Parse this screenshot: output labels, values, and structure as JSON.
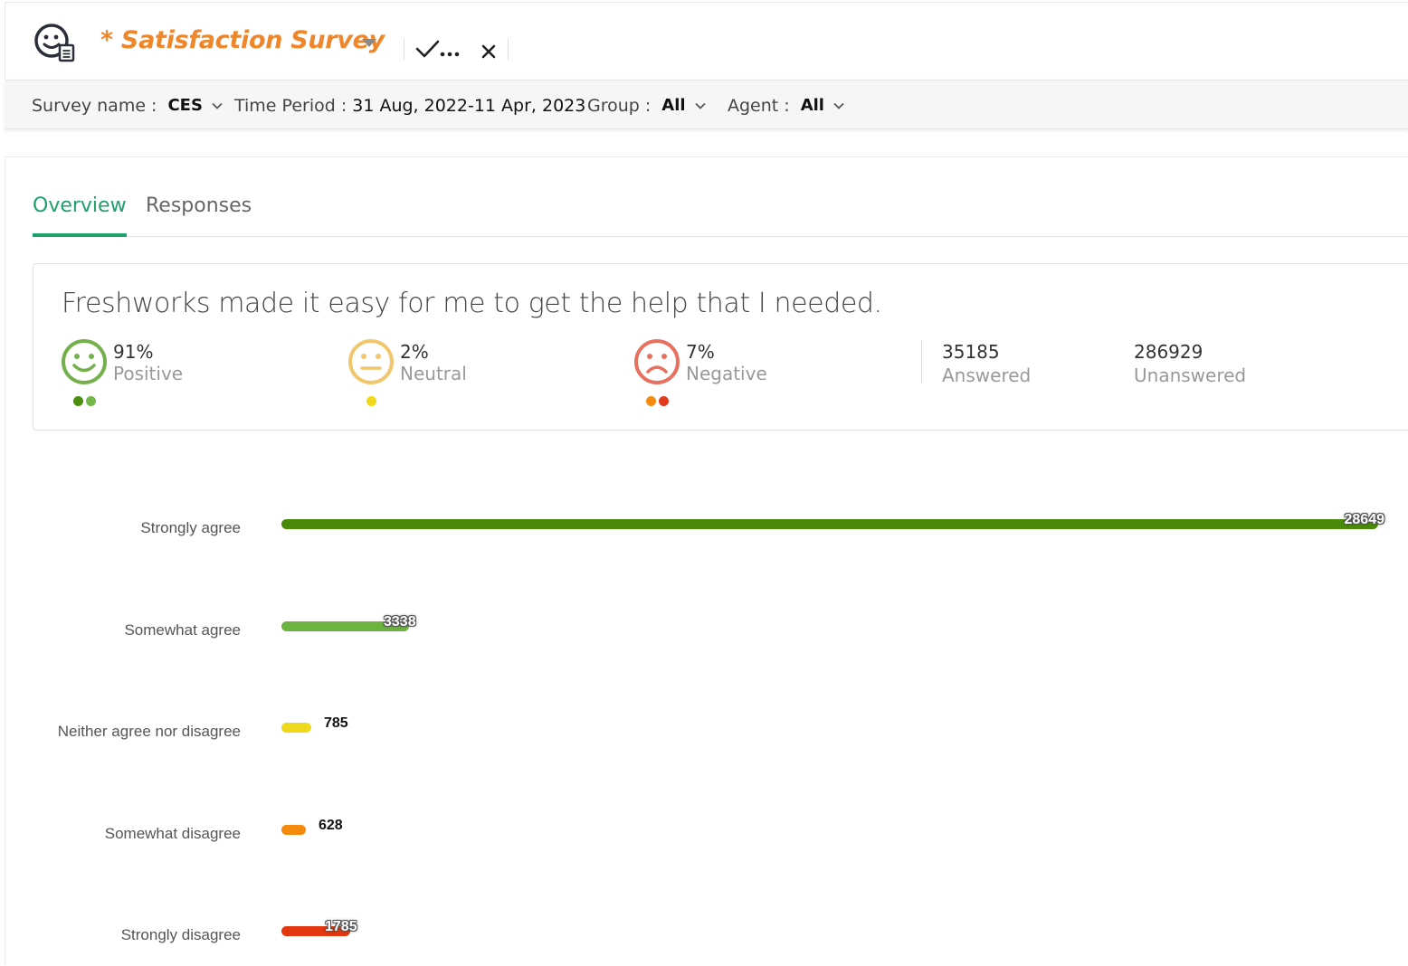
{
  "header": {
    "title": "* Satisfaction Survey",
    "icons": {
      "app": "smiley-document-icon",
      "dropdown": "caret-down-icon",
      "mark": "check-more-icon",
      "close": "close-icon"
    }
  },
  "filters": {
    "survey_name_label": "Survey name :",
    "survey_name_value": "CES",
    "time_period_label": "Time Period :",
    "time_period_value": "31 Aug, 2022-11 Apr, 2023",
    "group_label": "Group :",
    "group_value": "All",
    "agent_label": "Agent :",
    "agent_value": "All"
  },
  "tabs": {
    "overview": "Overview",
    "responses": "Responses"
  },
  "summary": {
    "question": "Freshworks made it easy for me to get the help that I needed.",
    "positive": {
      "pct": "91%",
      "label": "Positive",
      "icon": "smile-face-icon",
      "color": "#74b04c",
      "dots": [
        "#4a8f10",
        "#74b64a"
      ]
    },
    "neutral": {
      "pct": "2%",
      "label": "Neutral",
      "icon": "neutral-face-icon",
      "color": "#f2c66d",
      "dots": [
        "#f0d81a"
      ]
    },
    "negative": {
      "pct": "7%",
      "label": "Negative",
      "icon": "sad-face-icon",
      "color": "#e8705e",
      "dots": [
        "#f58a0f",
        "#e23b1b"
      ]
    },
    "answered": {
      "num": "35185",
      "label": "Answered"
    },
    "unanswered": {
      "num": "286929",
      "label": "Unanswered"
    }
  },
  "chart_data": {
    "type": "bar",
    "orientation": "horizontal",
    "categories": [
      "Strongly agree",
      "Somewhat agree",
      "Neither agree nor disagree",
      "Somewhat disagree",
      "Strongly disagree"
    ],
    "values": [
      28649,
      3338,
      785,
      628,
      1785
    ],
    "colors": [
      "#4a8a0b",
      "#6db33f",
      "#f0d81a",
      "#f58a0f",
      "#e2370f"
    ],
    "labels": [
      "28649",
      "3338",
      "785",
      "628",
      "1785"
    ],
    "grid": false
  }
}
